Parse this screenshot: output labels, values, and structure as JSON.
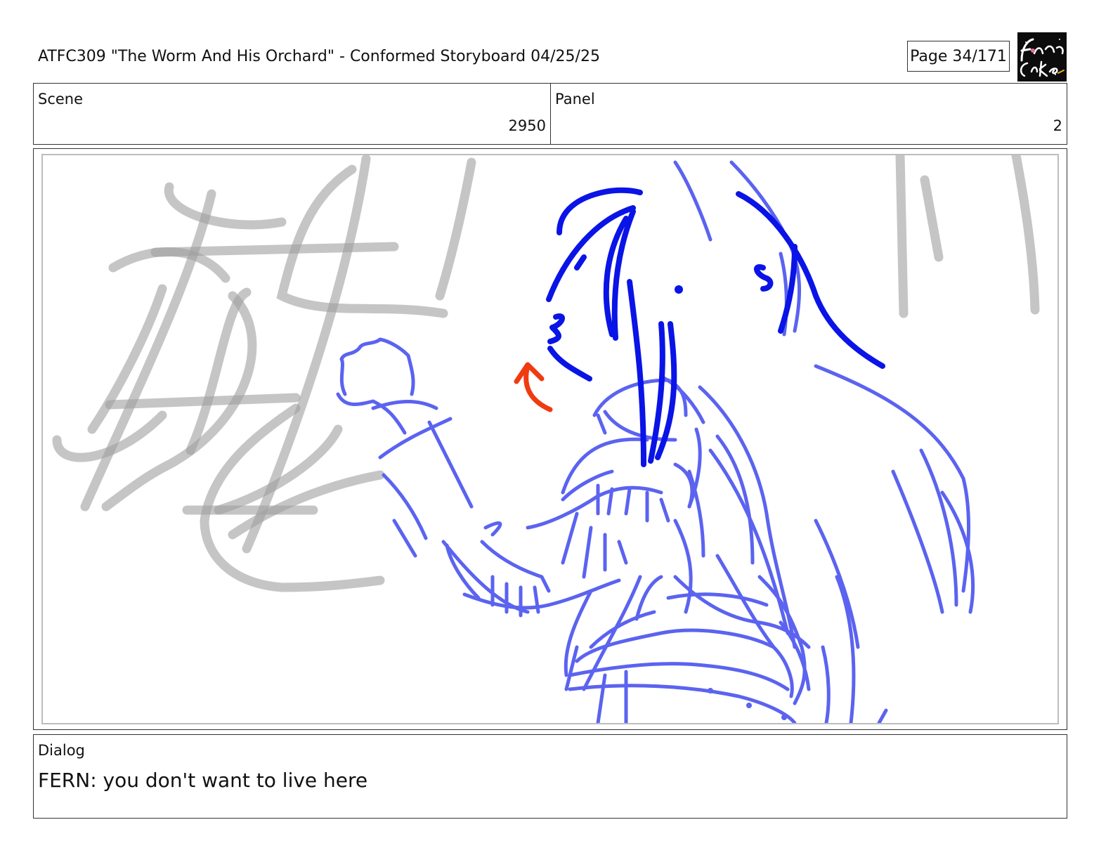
{
  "header": {
    "title": "ATFC309 \"The Worm And His Orchard\" - Conformed Storyboard 04/25/25",
    "page_label": "Page",
    "page_number": "34/171",
    "logo_text": "Fionna and Cake"
  },
  "scene": {
    "label": "Scene",
    "value": "2950"
  },
  "panel": {
    "label": "Panel",
    "value": "2"
  },
  "dialog": {
    "label": "Dialog",
    "text": "FERN: you don't want to live here"
  },
  "colors": {
    "background_sketch": "#9e9e9e",
    "character_lines": "#5b63f0",
    "key_lines": "#0a14e6",
    "motion_arrow": "#f03a10"
  }
}
